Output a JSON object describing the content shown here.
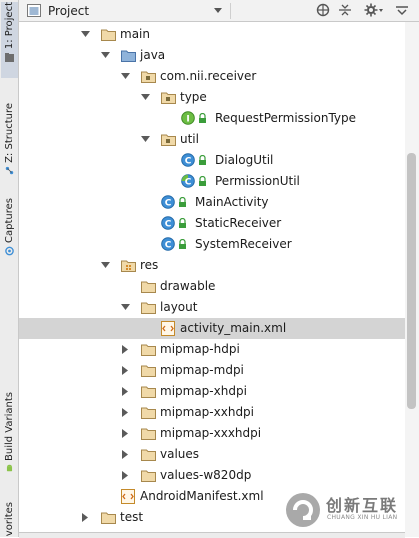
{
  "side_tabs": {
    "project": "1: Project",
    "structure": "Z: Structure",
    "captures": "Captures",
    "build_variants": "Build Variants",
    "favorites": "avorites"
  },
  "header": {
    "title": "Project"
  },
  "tree": {
    "main": "main",
    "java": "java",
    "package": "com.nii.receiver",
    "type_folder": "type",
    "request_permission_type": "RequestPermissionType",
    "util_folder": "util",
    "dialog_util": "DialogUtil",
    "permission_util": "PermissionUtil",
    "main_activity": "MainActivity",
    "static_receiver": "StaticReceiver",
    "system_receiver": "SystemReceiver",
    "res": "res",
    "drawable": "drawable",
    "layout": "layout",
    "activity_main": "activity_main.xml",
    "mipmap_hdpi": "mipmap-hdpi",
    "mipmap_mdpi": "mipmap-mdpi",
    "mipmap_xhdpi": "mipmap-xhdpi",
    "mipmap_xxhdpi": "mipmap-xxhdpi",
    "mipmap_xxxhdpi": "mipmap-xxxhdpi",
    "values": "values",
    "values_w820dp": "values-w820dp",
    "manifest": "AndroidManifest.xml",
    "test": "test"
  },
  "watermark": {
    "main": "创新互联",
    "sub": "CHUANG XIN HU LIAN"
  },
  "colors": {
    "class_icon": "#3e8fd6",
    "interface_icon": "#6cbd43",
    "folder": "#dcb67a",
    "selection": "#d4d4d4"
  },
  "icons": [
    "project-icon",
    "globe-icon",
    "sync-icon",
    "gear-icon",
    "hide-icon",
    "folder-icon",
    "class-icon",
    "interface-icon",
    "xml-icon",
    "lock-icon"
  ]
}
